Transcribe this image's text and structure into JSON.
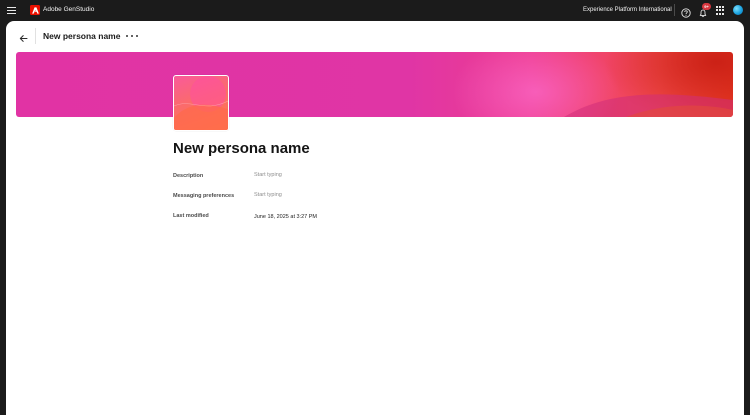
{
  "topbar": {
    "app_name": "Adobe GenStudio",
    "org_name": "Experience Platform International",
    "notification_count": "9+",
    "icons": {
      "menu": "hamburger-menu-icon",
      "logo": "adobe-logo",
      "help": "help-icon",
      "notifications": "bell-icon",
      "apps": "app-grid-icon",
      "profile": "avatar"
    }
  },
  "header": {
    "title": "New persona name"
  },
  "persona": {
    "name": "New persona name",
    "fields": {
      "description": {
        "label": "Description",
        "placeholder": "Start typing"
      },
      "messaging_preferences": {
        "label": "Messaging preferences",
        "placeholder": "Start typing"
      },
      "last_modified": {
        "label": "Last modified",
        "value": "June 18, 2025 at 3:27 PM"
      }
    }
  },
  "colors": {
    "topbar_bg": "#1b1b1b",
    "brand_red": "#eb1000",
    "banner_pink": "#e133a4",
    "banner_orange": "#e93a23",
    "badge_red": "#d7373f"
  }
}
